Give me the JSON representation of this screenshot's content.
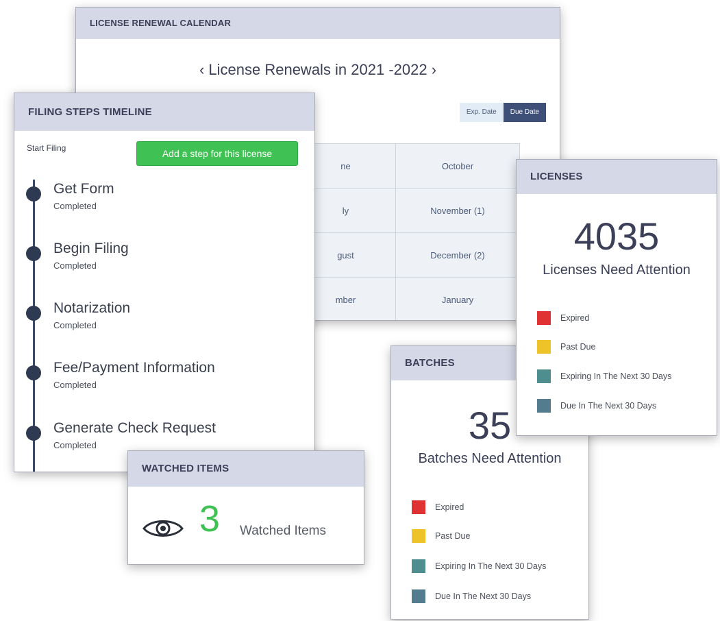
{
  "calendar": {
    "title": "LICENSE RENEWAL CALENDAR",
    "prev_arrow": "‹",
    "range_label": "License Renewals in 2021 -2022",
    "next_arrow": "›",
    "toggle": {
      "option1": "Exp. Date",
      "option2": "Due Date",
      "selected": "Due Date"
    },
    "months": [
      [
        "ne",
        "October"
      ],
      [
        "ly",
        "November (1)"
      ],
      [
        "gust",
        "December (2)"
      ],
      [
        "mber",
        "January"
      ]
    ]
  },
  "timeline": {
    "title": "FILING STEPS TIMELINE",
    "start_label": "Start Filing",
    "add_button": "Add a step for this license",
    "steps": [
      {
        "name": "Get Form",
        "status": "Completed"
      },
      {
        "name": "Begin Filing",
        "status": "Completed"
      },
      {
        "name": "Notarization",
        "status": "Completed"
      },
      {
        "name": "Fee/Payment Information",
        "status": "Completed"
      },
      {
        "name": "Generate Check Request",
        "status": "Completed"
      }
    ]
  },
  "watched": {
    "title": "WATCHED ITEMS",
    "count": "3",
    "label": "Watched Items",
    "icon": "eye-icon"
  },
  "batches": {
    "title": "BATCHES",
    "count": "35",
    "label": "Batches Need Attention",
    "legend": [
      "Expired",
      "Past Due",
      "Expiring In The Next 30 Days",
      "Due In The Next 30 Days"
    ]
  },
  "licenses": {
    "title": "LICENSES",
    "count": "4035",
    "label": "Licenses Need Attention",
    "legend": [
      "Expired",
      "Past Due",
      "Expiring In The Next 30 Days",
      "Due In The Next 30 Days"
    ]
  },
  "colors": {
    "header_bg": "#d5d8e6",
    "expired": "#e03232",
    "past_due": "#eec32a",
    "expiring_30": "#4e8e8e",
    "due_30": "#537d8e",
    "green": "#3fc153",
    "navy": "#3e4f78"
  }
}
